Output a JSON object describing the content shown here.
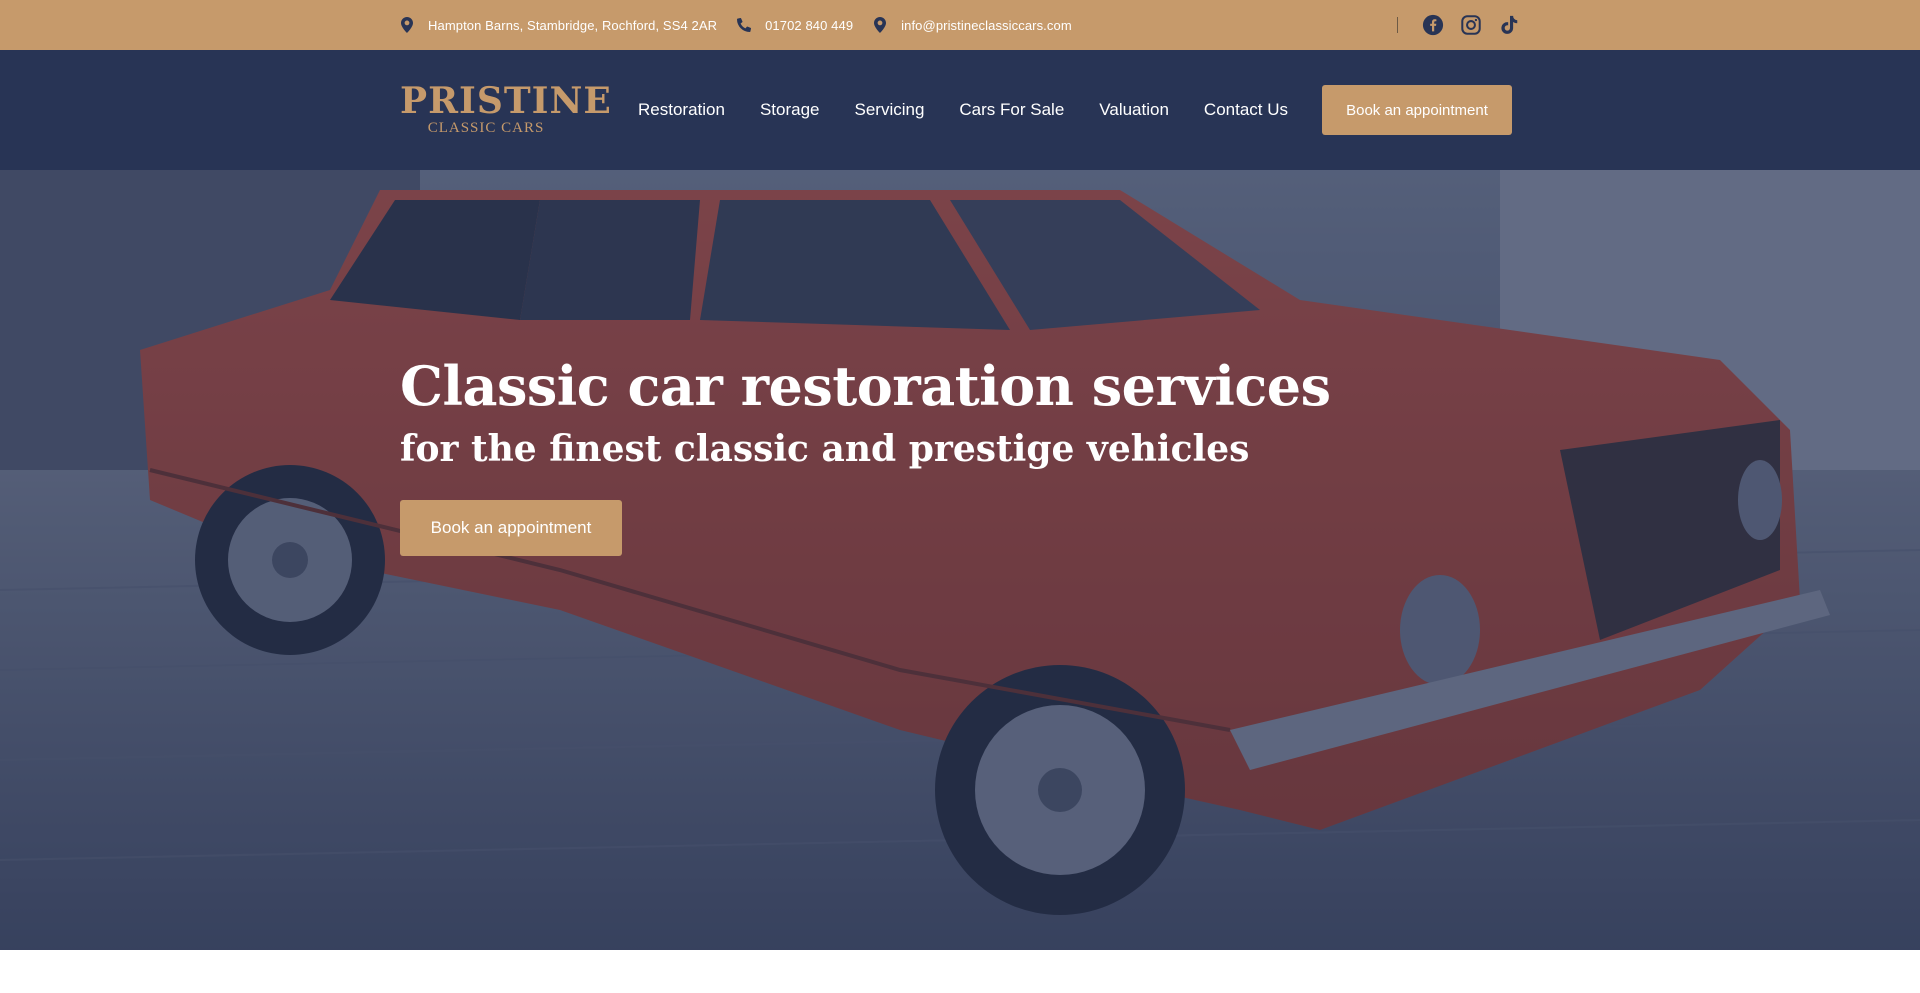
{
  "topbar": {
    "address": "Hampton Barns, Stambridge, Rochford, SS4 2AR",
    "phone": "01702 840 449",
    "email": "info@pristineclassiccars.com",
    "icons": {
      "address": "map-pin-icon",
      "phone": "phone-icon",
      "email": "map-pin-icon"
    },
    "social": [
      "facebook-icon",
      "instagram-icon",
      "tiktok-icon"
    ]
  },
  "header": {
    "logo": {
      "line1": "PRISTINE",
      "line2": "CLASSIC CARS"
    },
    "nav": [
      {
        "label": "Restoration"
      },
      {
        "label": "Storage"
      },
      {
        "label": "Servicing"
      },
      {
        "label": "Cars For Sale"
      },
      {
        "label": "Valuation"
      },
      {
        "label": "Contact Us"
      }
    ],
    "cta": "Book an appointment"
  },
  "hero": {
    "title": "Classic car restoration services",
    "subtitle": "for the finest classic and prestige vehicles",
    "cta": "Book an appointment"
  },
  "colors": {
    "accent": "#c69a6b",
    "navy": "#283455",
    "white": "#ffffff"
  }
}
